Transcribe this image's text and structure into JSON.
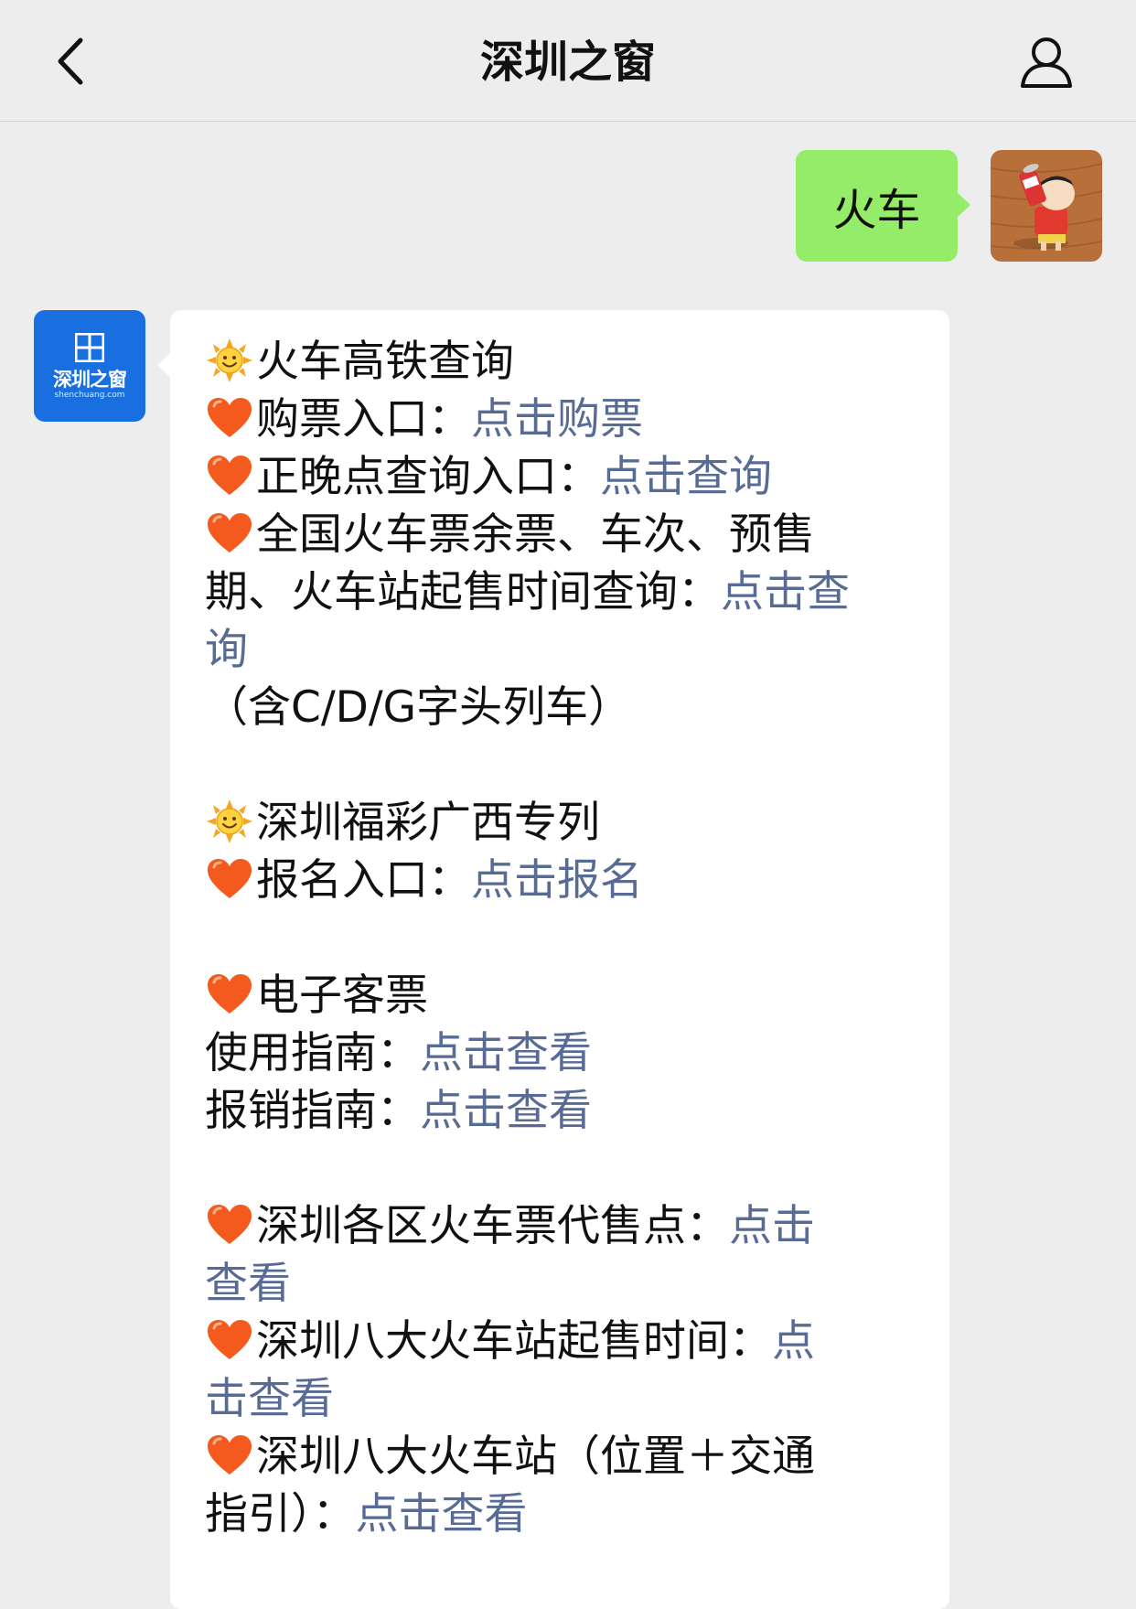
{
  "header": {
    "title": "深圳之窗",
    "back_icon": "chevron-left-icon",
    "profile_icon": "person-icon"
  },
  "user_message": {
    "text": "火车",
    "bubble_color": "#95ec69"
  },
  "bot": {
    "avatar_text": "深圳之窗",
    "avatar_url": "shenchuang.com",
    "avatar_color": "#1a6fe0"
  },
  "reply": {
    "link_color": "#576b95",
    "section1": {
      "heading": "火车高铁查询",
      "buy_label": "购票入口：",
      "buy_link": "点击购票",
      "punctual_label": "正晚点查询入口：",
      "punctual_link": "点击查询",
      "tickets_label_1": "全国火车票余票、车次、预售",
      "tickets_label_2": "期、火车站起售时间查询：",
      "tickets_link_1": "点击查",
      "tickets_link_2": "询",
      "note": "（含C/D/G字头列车）"
    },
    "section2": {
      "heading": "深圳福彩广西专列",
      "signup_label": "报名入口：",
      "signup_link": "点击报名"
    },
    "section3": {
      "heading": "电子客票",
      "guide_label": "使用指南：",
      "guide_link": "点击查看",
      "reimburse_label": "报销指南：",
      "reimburse_link": "点击查看"
    },
    "section4": {
      "agents_label": "深圳各区火车票代售点：",
      "agents_link_1": "点击",
      "agents_link_2": "查看",
      "sale_time_label": "深圳八大火车站起售时间：",
      "sale_time_link_1": "点",
      "sale_time_link_2": "击查看",
      "stations_label_1": "深圳八大火车站（位置＋交通",
      "stations_label_2": "指引）：",
      "stations_link": "点击查看"
    }
  }
}
